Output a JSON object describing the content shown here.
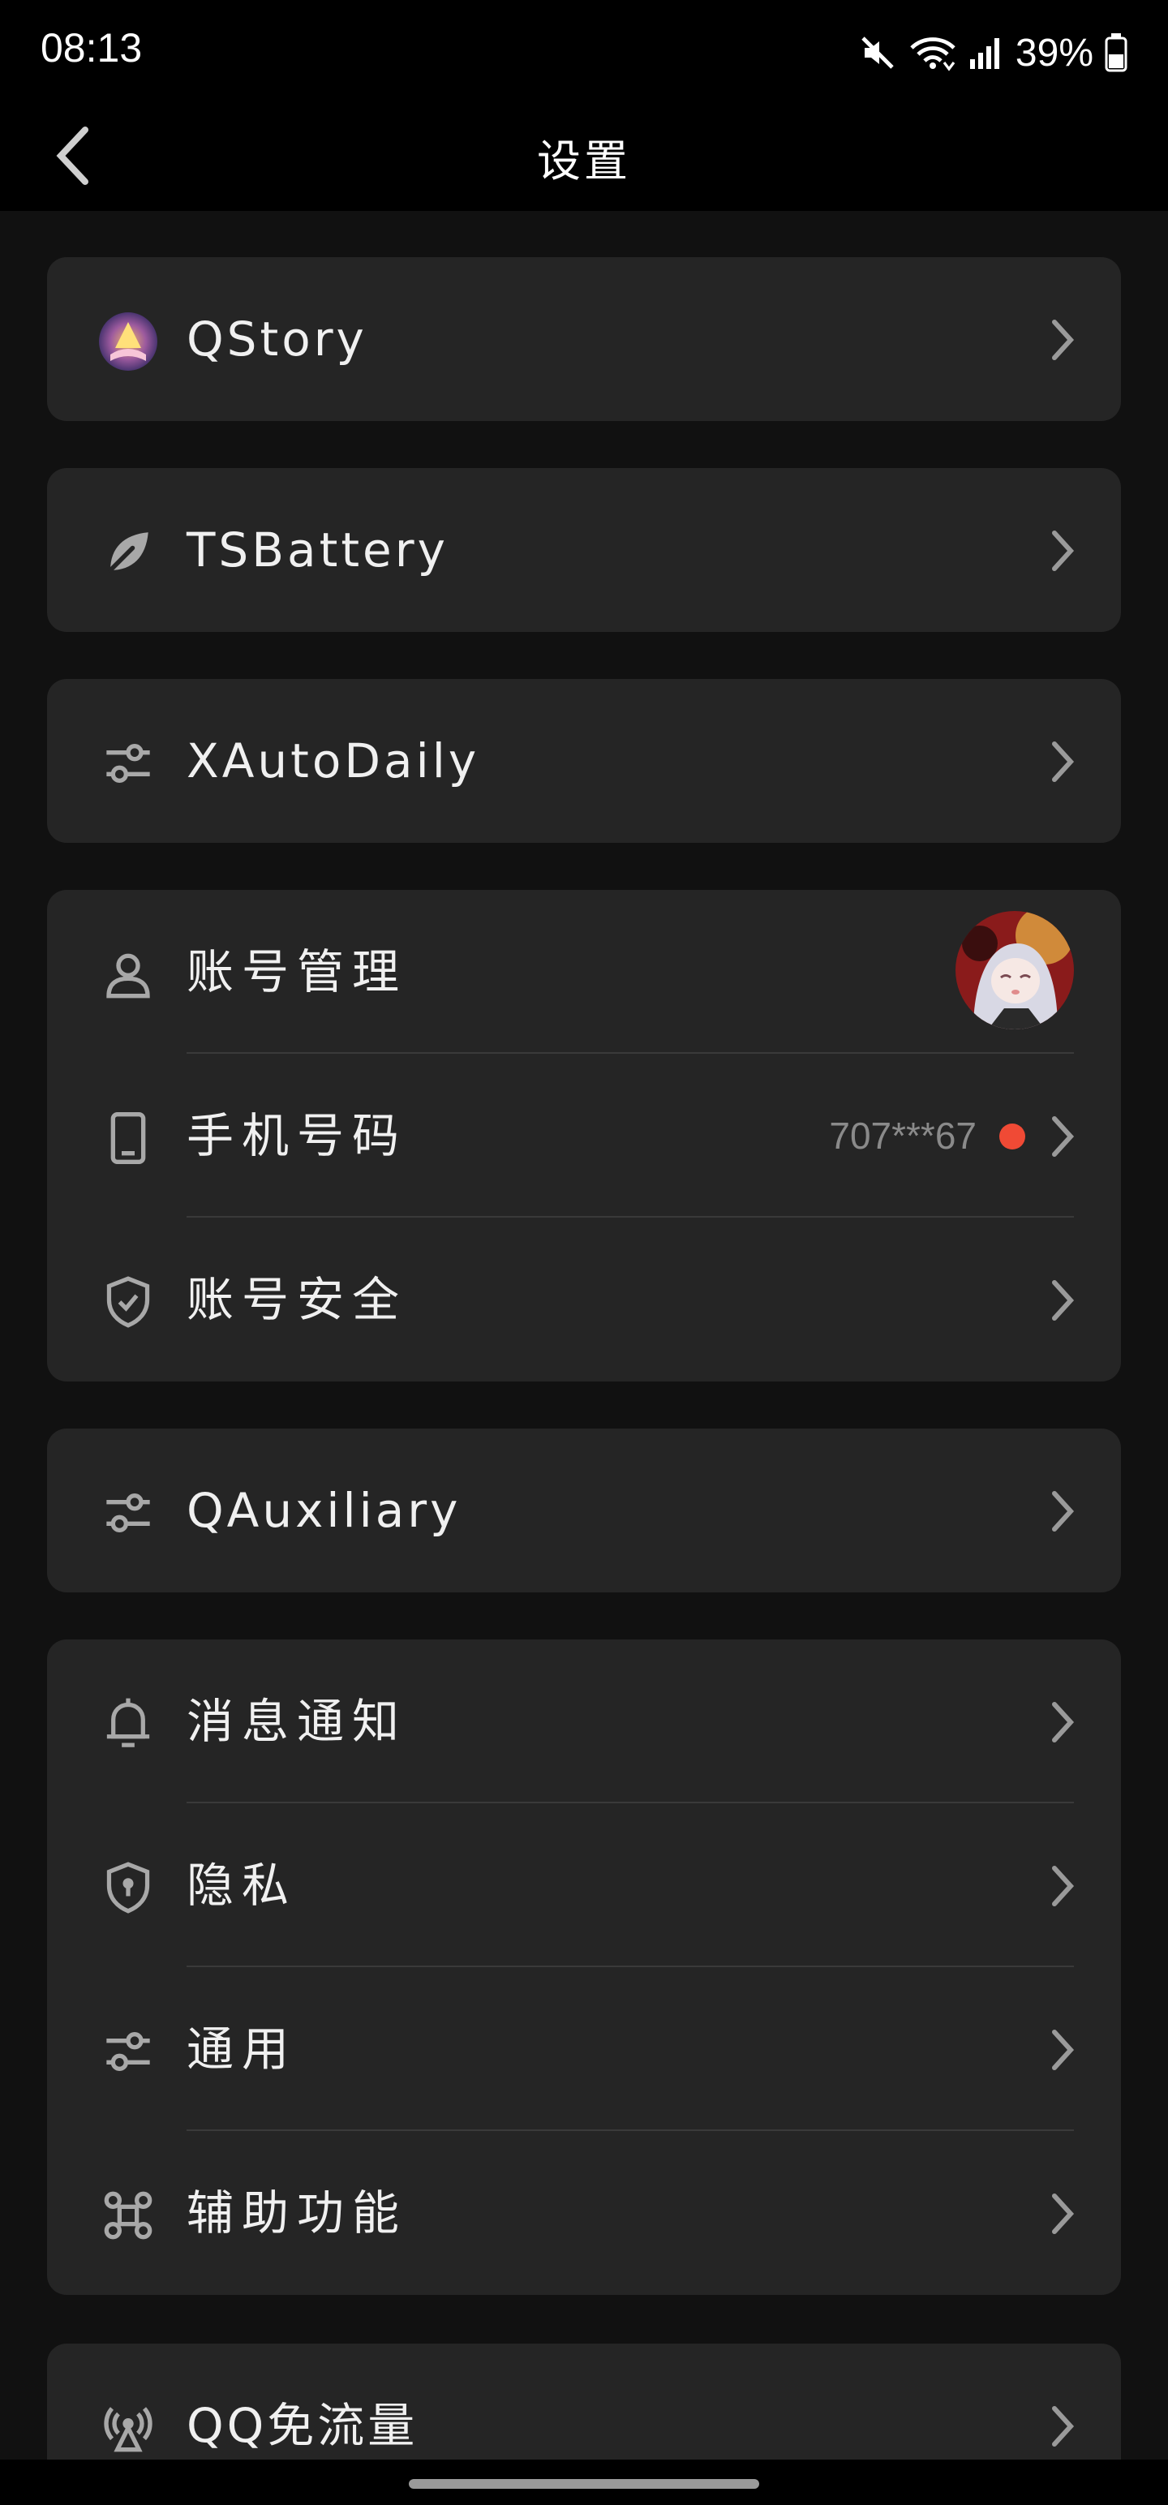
{
  "status_bar": {
    "time": "08:13",
    "battery_percent": "39%",
    "icons": [
      "mute-icon",
      "wifi-icon",
      "signal-icon",
      "battery-icon"
    ]
  },
  "header": {
    "title": "设置",
    "back_icon": "chevron-left-icon"
  },
  "colors": {
    "background": "#111111",
    "card": "#252525",
    "bar": "#000000",
    "text": "#f0f0f0",
    "muted": "#8a8a8a",
    "accent_dot": "#f04a35"
  },
  "cards": [
    {
      "items": [
        {
          "label": "QStory",
          "icon": "qstory-logo-icon"
        }
      ]
    },
    {
      "items": [
        {
          "label": "TSBattery",
          "icon": "leaf-icon"
        }
      ]
    },
    {
      "items": [
        {
          "label": "XAutoDaily",
          "icon": "sliders-icon"
        }
      ]
    },
    {
      "items": [
        {
          "label": "账号管理",
          "icon": "person-icon",
          "trailing": "avatar"
        },
        {
          "label": "手机号码",
          "icon": "phone-icon",
          "value": "707***67",
          "badge": "red-dot"
        },
        {
          "label": "账号安全",
          "icon": "shield-check-icon"
        }
      ]
    },
    {
      "items": [
        {
          "label": "QAuxiliary",
          "icon": "sliders-icon"
        }
      ]
    },
    {
      "items": [
        {
          "label": "消息通知",
          "icon": "bell-icon"
        },
        {
          "label": "隐私",
          "icon": "shield-lock-icon"
        },
        {
          "label": "通用",
          "icon": "sliders-icon"
        },
        {
          "label": "辅助功能",
          "icon": "command-icon"
        }
      ]
    },
    {
      "items": [
        {
          "label": "QQ免流量",
          "icon": "broadcast-icon"
        }
      ]
    }
  ]
}
